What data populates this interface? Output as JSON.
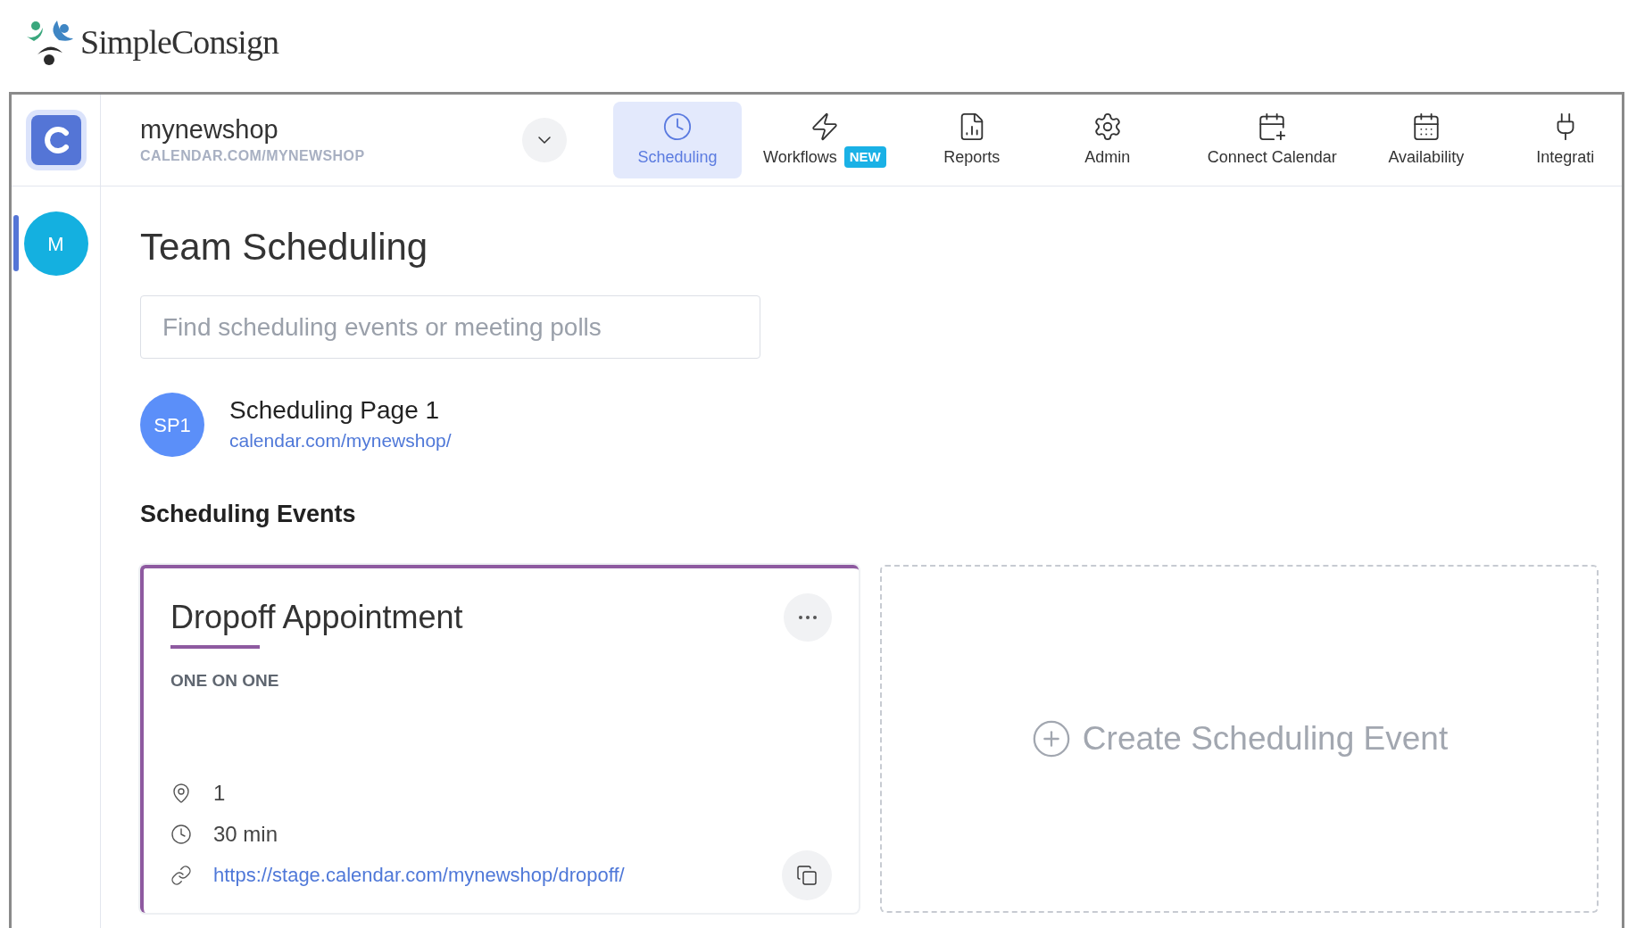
{
  "brand": {
    "name": "SimpleConsign"
  },
  "account": {
    "name": "mynewshop",
    "url": "CALENDAR.COM/MYNEWSHOP"
  },
  "nav_main": [
    {
      "label": "Scheduling",
      "kind": "clock",
      "selected": true
    },
    {
      "label": "Workflows",
      "kind": "bolt",
      "badge": "NEW",
      "selected": false
    },
    {
      "label": "Reports",
      "kind": "report",
      "selected": false
    },
    {
      "label": "Admin",
      "kind": "gear",
      "selected": false
    }
  ],
  "nav_settings": [
    {
      "label": "Connect Calendar",
      "kind": "calendar-plus",
      "selected": false
    },
    {
      "label": "Availability",
      "kind": "calendar-grid",
      "selected": false
    },
    {
      "label": "Integrati",
      "kind": "plug",
      "selected": false
    }
  ],
  "sidebar": {
    "avatar": "M",
    "selected": true
  },
  "page": {
    "title": "Team Scheduling",
    "search": {
      "placeholder": "Find scheduling events or meeting polls"
    },
    "scheduling_page": {
      "avatar": "SP1",
      "title": "Scheduling Page 1",
      "link": "calendar.com/mynewshop/"
    },
    "section_title": "Scheduling Events",
    "events": [
      {
        "title": "Dropoff Appointment",
        "type": "ONE ON ONE",
        "color": "#8e5aa0",
        "details": [
          {
            "kind": "location",
            "text": "1"
          },
          {
            "kind": "duration",
            "text": "30 min"
          },
          {
            "kind": "link",
            "text": "https://stage.calendar.com/mynewshop/dropoff/"
          }
        ]
      }
    ],
    "create_label": "Create Scheduling Event"
  }
}
